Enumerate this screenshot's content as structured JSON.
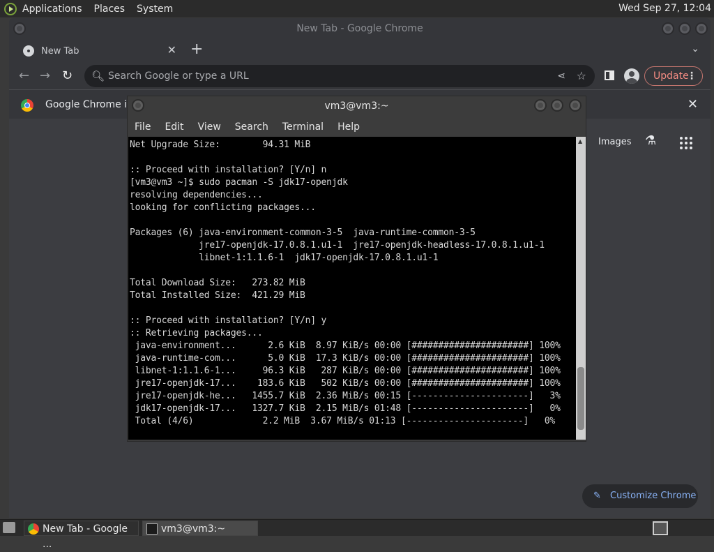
{
  "panel": {
    "menus": [
      "Applications",
      "Places",
      "System"
    ],
    "clock": "Wed Sep 27, 12:04"
  },
  "chrome": {
    "window_title": "New Tab - Google Chrome",
    "tab_title": "New Tab",
    "omnibox_placeholder": "Search Google or type a URL",
    "update_label": "Update",
    "infobar_text": "Google Chrome isn",
    "images_link": "Images",
    "customize_label": "Customize Chrome"
  },
  "terminal": {
    "title": "vm3@vm3:~",
    "menus": [
      "File",
      "Edit",
      "View",
      "Search",
      "Terminal",
      "Help"
    ],
    "lines": [
      "Net Upgrade Size:        94.31 MiB",
      "",
      ":: Proceed with installation? [Y/n] n",
      "[vm3@vm3 ~]$ sudo pacman -S jdk17-openjdk",
      "resolving dependencies...",
      "looking for conflicting packages...",
      "",
      "Packages (6) java-environment-common-3-5  java-runtime-common-3-5",
      "             jre17-openjdk-17.0.8.1.u1-1  jre17-openjdk-headless-17.0.8.1.u1-1",
      "             libnet-1:1.1.6-1  jdk17-openjdk-17.0.8.1.u1-1",
      "",
      "Total Download Size:   273.82 MiB",
      "Total Installed Size:  421.29 MiB",
      "",
      ":: Proceed with installation? [Y/n] y",
      ":: Retrieving packages...",
      " java-environment...      2.6 KiB  8.97 KiB/s 00:00 [######################] 100%",
      " java-runtime-com...      5.0 KiB  17.3 KiB/s 00:00 [######################] 100%",
      " libnet-1:1.1.6-1...     96.3 KiB   287 KiB/s 00:00 [######################] 100%",
      " jre17-openjdk-17...    183.6 KiB   502 KiB/s 00:00 [######################] 100%",
      " jre17-openjdk-he...   1455.7 KiB  2.36 MiB/s 00:15 [----------------------]   3%",
      " jdk17-openjdk-17...   1327.7 KiB  2.15 MiB/s 01:48 [----------------------]   0%",
      " Total (4/6)             2.2 MiB  3.67 MiB/s 01:13 [----------------------]   0%"
    ]
  },
  "taskbar": {
    "items": [
      "New Tab - Google ...",
      "vm3@vm3:~"
    ]
  }
}
